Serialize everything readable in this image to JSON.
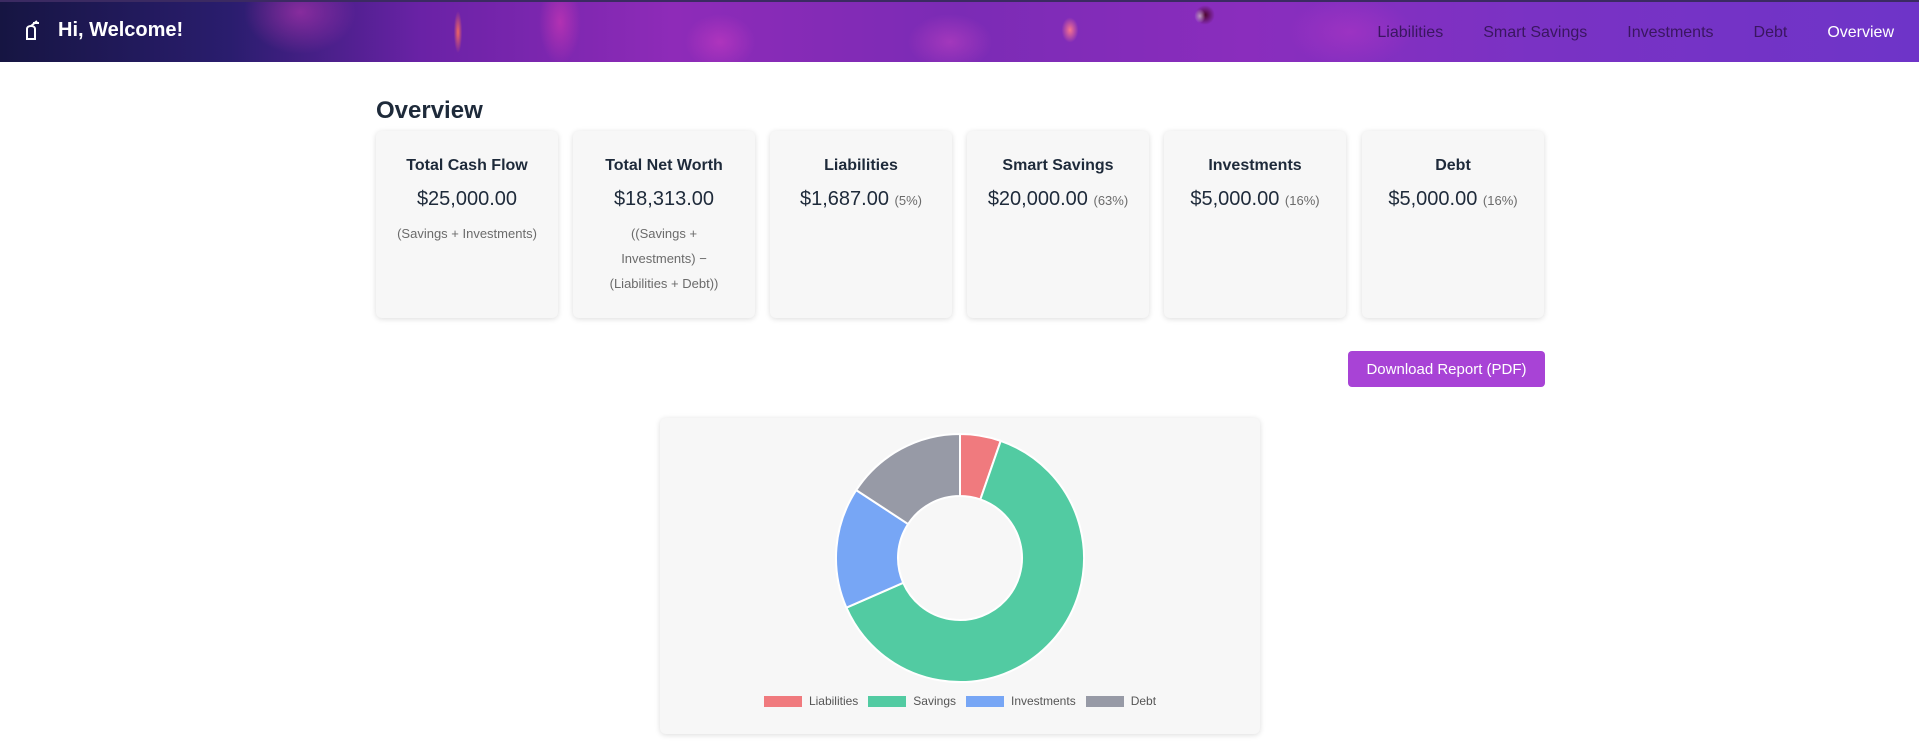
{
  "header": {
    "welcome": "Hi, Welcome!",
    "nav": [
      "Liabilities",
      "Smart Savings",
      "Investments",
      "Debt",
      "Overview"
    ],
    "active": "Overview"
  },
  "overview": {
    "title": "Overview",
    "cards": [
      {
        "title": "Total Cash Flow",
        "value": "$25,000.00",
        "pct": "",
        "note": "(Savings + Investments)"
      },
      {
        "title": "Total Net Worth",
        "value": "$18,313.00",
        "pct": "",
        "note": "((Savings + Investments) − (Liabilities + Debt))"
      },
      {
        "title": "Liabilities",
        "value": "$1,687.00",
        "pct": "(5%)",
        "note": ""
      },
      {
        "title": "Smart Savings",
        "value": "$20,000.00",
        "pct": "(63%)",
        "note": ""
      },
      {
        "title": "Investments",
        "value": "$5,000.00",
        "pct": "(16%)",
        "note": ""
      },
      {
        "title": "Debt",
        "value": "$5,000.00",
        "pct": "(16%)",
        "note": ""
      }
    ],
    "download_label": "Download Report (PDF)"
  },
  "chart_data": {
    "type": "pie",
    "variant": "doughnut",
    "categories": [
      "Liabilities",
      "Savings",
      "Investments",
      "Debt"
    ],
    "values": [
      1687,
      20000,
      5000,
      5000
    ],
    "colors": [
      "#f07a7e",
      "#52cba2",
      "#77a6f5",
      "#979aa6"
    ],
    "legend": "bottom"
  },
  "icons": {
    "logo": "leaf-logo-icon"
  }
}
